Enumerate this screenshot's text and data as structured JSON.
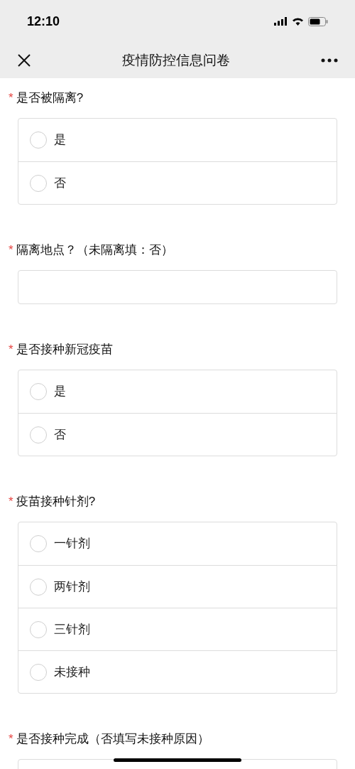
{
  "status_bar": {
    "time": "12:10"
  },
  "nav_bar": {
    "title": "疫情防控信息问卷"
  },
  "questions": [
    {
      "mark": "*",
      "title": "是否被隔离?",
      "kind": "radio",
      "options": [
        {
          "label": "是",
          "selected": false
        },
        {
          "label": "否",
          "selected": false
        }
      ]
    },
    {
      "mark": "*",
      "title": "隔离地点？（未隔离填：否）",
      "kind": "text"
    },
    {
      "mark": "*",
      "title": "是否接种新冠疫苗",
      "kind": "radio",
      "options": [
        {
          "label": "是",
          "selected": false
        },
        {
          "label": "否",
          "selected": false
        }
      ]
    },
    {
      "mark": "*",
      "title": "疫苗接种针剂?",
      "kind": "radio",
      "options": [
        {
          "label": "一针剂",
          "selected": false
        },
        {
          "label": "两针剂",
          "selected": false
        },
        {
          "label": "三针剂",
          "selected": false
        },
        {
          "label": "未接种",
          "selected": false
        }
      ]
    },
    {
      "mark": "*",
      "title": "是否接种完成（否填写未接种原因）",
      "kind": "text"
    }
  ]
}
